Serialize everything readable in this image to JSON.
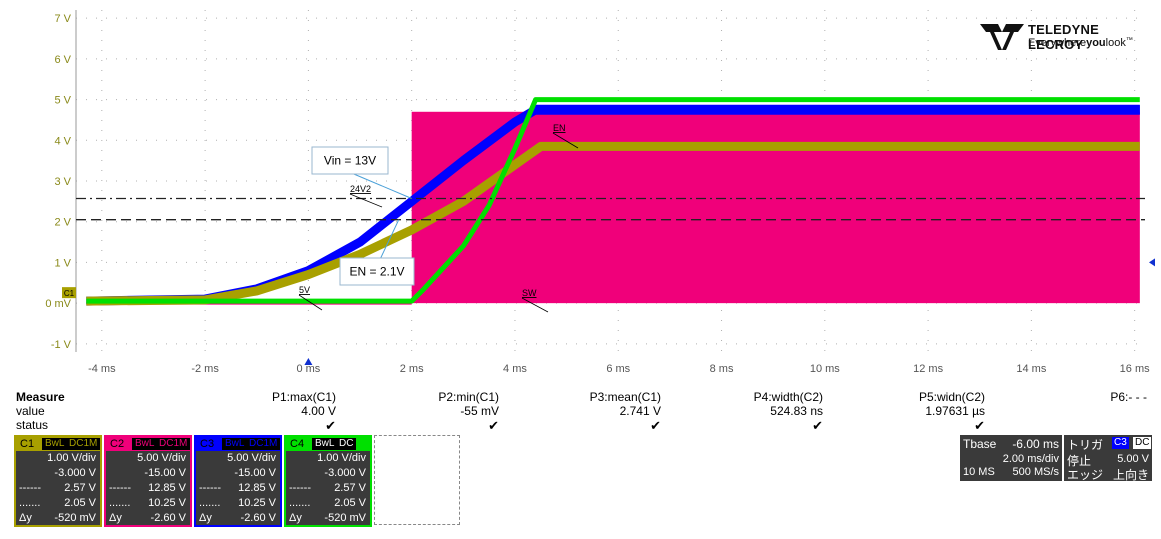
{
  "brand": {
    "name": "TELEDYNE LECROY",
    "tagline_pre": "Everywhere",
    "tagline_bold": "you",
    "tagline_post": "look",
    "tm": "™"
  },
  "y_axis": {
    "labels": [
      "7 V",
      "6 V",
      "5 V",
      "4 V",
      "3 V",
      "2 V",
      "1 V",
      "0 mV",
      "-1 V"
    ],
    "values": [
      7,
      6,
      5,
      4,
      3,
      2,
      1,
      0,
      -1
    ]
  },
  "x_axis": {
    "labels": [
      "-4 ms",
      "-2 ms",
      "0 ms",
      "2 ms",
      "4 ms",
      "6 ms",
      "8 ms",
      "10 ms",
      "12 ms",
      "14 ms",
      "16 ms"
    ],
    "values": [
      -4,
      -2,
      0,
      2,
      4,
      6,
      8,
      10,
      12,
      14,
      16
    ]
  },
  "annotations": {
    "vin": "Vin = 13V",
    "en": "EN = 2.1V",
    "label_24v2": "24V2",
    "label_en": "EN",
    "label_5v": "5V",
    "label_sw": "SW",
    "c1_marker": "C1"
  },
  "colors": {
    "c1": "#a8a000",
    "c2": "#f0007a",
    "c3": "#0000ff",
    "c4": "#00e000",
    "grid": "#b0b0b0"
  },
  "chart_data": {
    "type": "line",
    "xlabel": "",
    "ylabel": "",
    "xlim": [
      -4.5,
      16.2
    ],
    "ylim": [
      -1.2,
      7.2
    ],
    "series": [
      {
        "name": "EN",
        "x": [
          -4.3,
          -2,
          -1,
          0,
          1,
          2,
          3,
          4,
          4.5,
          16.1
        ],
        "y": [
          0.05,
          0.08,
          0.3,
          0.7,
          1.2,
          1.8,
          2.5,
          3.4,
          3.85,
          3.85
        ]
      },
      {
        "name": "24V2",
        "x": [
          -4.3,
          -2,
          -1,
          0,
          1,
          2,
          3,
          4,
          4.4,
          16.1
        ],
        "y": [
          0.05,
          0.1,
          0.35,
          0.8,
          1.5,
          2.5,
          3.5,
          4.45,
          4.75,
          4.75
        ]
      },
      {
        "name": "5V",
        "x": [
          -4.3,
          2.0,
          2.2,
          3.0,
          3.5,
          4.0,
          4.4,
          16.1
        ],
        "y": [
          0.05,
          0.05,
          0.3,
          1.4,
          2.4,
          3.8,
          5.0,
          5.0
        ]
      },
      {
        "name": "SW",
        "x": [
          -4.3,
          2.0,
          2.0,
          16.1
        ],
        "y": [
          0.0,
          0.0,
          4.7,
          4.7
        ]
      }
    ],
    "cursors": {
      "dash_dot": 2.57,
      "dash": 2.05
    }
  },
  "measure": {
    "title": "Measure",
    "row_value": "value",
    "row_status": "status",
    "params": [
      {
        "name": "P1:max(C1)",
        "value": "4.00 V",
        "status": "✔"
      },
      {
        "name": "P2:min(C1)",
        "value": "-55 mV",
        "status": "✔"
      },
      {
        "name": "P3:mean(C1)",
        "value": "2.741 V",
        "status": "✔"
      },
      {
        "name": "P4:width(C2)",
        "value": "524.83 ns",
        "status": "✔"
      },
      {
        "name": "P5:widn(C2)",
        "value": "1.97631 µs",
        "status": "✔"
      },
      {
        "name": "P6:- - -",
        "value": "",
        "status": ""
      }
    ]
  },
  "channels": [
    {
      "id": "C1",
      "bw": "BwL",
      "cpl": "DC1M",
      "vdiv": "1.00 V/div",
      "offset": "-3.000 V",
      "c_a": "2.57 V",
      "c_b": "2.05 V",
      "dy_label": "Δy",
      "dy": "-520 mV",
      "mk_a": "------",
      "mk_b": "......."
    },
    {
      "id": "C2",
      "bw": "BwL",
      "cpl": "DC1M",
      "vdiv": "5.00 V/div",
      "offset": "-15.00 V",
      "c_a": "12.85 V",
      "c_b": "10.25 V",
      "dy_label": "Δy",
      "dy": "-2.60 V",
      "mk_a": "------",
      "mk_b": "......."
    },
    {
      "id": "C3",
      "bw": "BwL",
      "cpl": "DC1M",
      "vdiv": "5.00 V/div",
      "offset": "-15.00 V",
      "c_a": "12.85 V",
      "c_b": "10.25 V",
      "dy_label": "Δy",
      "dy": "-2.60 V",
      "mk_a": "------",
      "mk_b": "......."
    },
    {
      "id": "C4",
      "bw": "BwL",
      "cpl": "DC",
      "vdiv": "1.00 V/div",
      "offset": "-3.000 V",
      "c_a": "2.57 V",
      "c_b": "2.05 V",
      "dy_label": "Δy",
      "dy": "-520 mV",
      "mk_a": "------",
      "mk_b": "......."
    }
  ],
  "timebase": {
    "tbase_label": "Tbase",
    "tbase": "-6.00 ms",
    "tdiv": "2.00 ms/div",
    "samples": "10 MS",
    "rate": "500 MS/s",
    "trig_label": "トリガ",
    "trig_ch": "C3",
    "trig_cpl": "DC",
    "state": "停止",
    "level": "5.00 V",
    "mode": "エッジ",
    "slope": "上向き"
  }
}
